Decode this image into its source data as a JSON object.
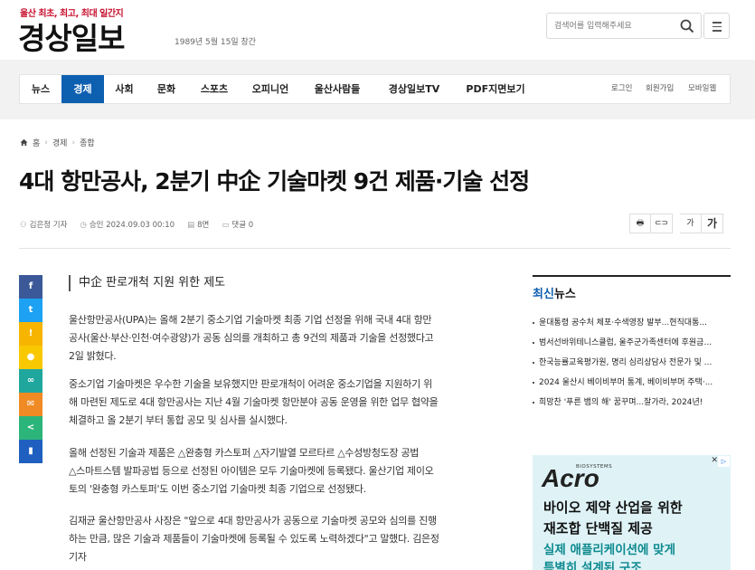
{
  "header": {
    "slogan": "울산 최초, 최고, 최대 일간지",
    "logo": "경상일보",
    "founded": "1989년 5월 15일 창간",
    "search_placeholder": "검색어를 입력해주세요",
    "search_icon": "search-icon",
    "menu_icon": "hamburger-menu-icon"
  },
  "nav": {
    "items": [
      "뉴스",
      "경제",
      "사회",
      "문화",
      "스포츠",
      "오피니언",
      "울산사람들",
      "경상일보TV",
      "PDF지면보기"
    ],
    "active_index": 1,
    "util": [
      "로그인",
      "회원가입",
      "모바일웹"
    ]
  },
  "breadcrumb": {
    "home": "홈",
    "section": "경제",
    "sub": "종합"
  },
  "article": {
    "title": "4대 항만공사, 2분기 中企 기술마켓 9건 제품·기술 선정",
    "author": "김은정 기자",
    "approved": "승인 2024.09.03 00:10",
    "pages": "8면",
    "comments": "댓글 0",
    "subhead": "中企 판로개척 지원 위한 제도",
    "paragraphs": [
      [
        "울산항만공사(UPA)는 올해 2분기 중소기업 기술마켓 최종 기업 선정을 위해 국내 4대 항만",
        "공사(울산·부산·인천·여수광양)가 공동 심의를 개최하고 총 9건의 제품과 기술을 선정했다고",
        "2일 밝혔다."
      ],
      [
        "중소기업 기술마켓은 우수한 기술을 보유했지만 판로개척이 어려운 중소기업을 지원하기 위",
        "해 마련된 제도로 4대 항만공사는 지난 4월 기술마켓 항만분야 공동 운영을 위한 업무 협약을",
        "체결하고 올 2분기 부터 통합 공모 및 심사를 실시했다."
      ],
      [
        "올해 선정된 기술과 제품은 △완충형 카스토퍼 △자기발열 모르타르 △수성방청도장 공법",
        "△스마트스템 발파공법 등으로 선정된 아이템은 모두 기술마켓에 등록됐다. 울산기업 제이오",
        "토의 '완충형 카스토퍼'도 이번 중소기업 기술마켓 최종 기업으로 선정됐다."
      ],
      [
        "김재균 울산항만공사 사장은 \"앞으로 4대 항만공사가 공동으로 기술마켓 공모와 심의를 진행",
        "하는 만큼, 많은 기술과 제품들이 기술마켓에 등록될 수 있도록 노력하겠다\"고 말했다. 김은정",
        "기자"
      ]
    ]
  },
  "tools": {
    "print_icon": "print-icon",
    "link_icon": "link-icon",
    "font_small": "가",
    "font_large": "가"
  },
  "share": [
    {
      "icon": "facebook-icon",
      "color": "#3b5998",
      "glyph": "f"
    },
    {
      "icon": "twitter-icon",
      "color": "#1da1f2",
      "glyph": "t"
    },
    {
      "icon": "kakaostory-icon",
      "color": "#f7b500",
      "glyph": "!"
    },
    {
      "icon": "kakaotalk-icon",
      "color": "#f9c800",
      "glyph": "●"
    },
    {
      "icon": "link-copy-icon",
      "color": "#1fa79e",
      "glyph": "∞"
    },
    {
      "icon": "email-icon",
      "color": "#f08a24",
      "glyph": "✉"
    },
    {
      "icon": "share-icon",
      "color": "#2bb57a",
      "glyph": "<"
    },
    {
      "icon": "bookmark-icon",
      "color": "#1f5fbf",
      "glyph": "▮"
    }
  ],
  "sidebar": {
    "heading_accent": "최신",
    "heading_rest": "뉴스",
    "items": [
      "윤대통령 공수처 체포·수색영장 발부...현직대통...",
      "범서선바위테니스클럽, 울주군가족센터에 후원금...",
      "한국능률교육평가원, 명리 심리상담사 전문가 및 ...",
      "2024 울산시 베이비부머 통계, 베이비부머 주택·...",
      "희망찬 '푸른 뱀의 해' 꿈꾸며...잘가라, 2024년!"
    ]
  },
  "ad": {
    "brand_small": "BIOSYSTEMS",
    "brand": "Acro",
    "line1": "바이오 제약 산업을 위한",
    "line2": "재조합 단백질 제공",
    "line3": "실제 애플리케이션에 맞게",
    "line4": "특별히 설계된 구조",
    "ad_choices": "▷",
    "close": "✕"
  }
}
